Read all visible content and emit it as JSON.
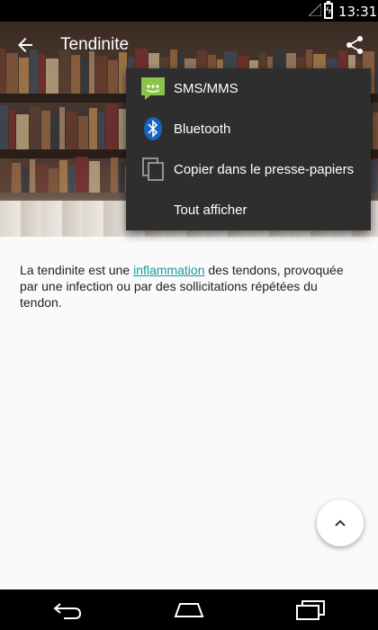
{
  "status_bar": {
    "time": "13:31"
  },
  "toolbar": {
    "title": "Tendinite"
  },
  "share_menu": {
    "items": [
      {
        "label": "SMS/MMS",
        "icon": "sms-icon"
      },
      {
        "label": "Bluetooth",
        "icon": "bluetooth-icon"
      },
      {
        "label": "Copier dans le presse-papiers",
        "icon": "copy-icon"
      },
      {
        "label": "Tout afficher",
        "icon": ""
      }
    ]
  },
  "article": {
    "before_link": "La tendinite est une ",
    "link_text": "inflammation",
    "after_link": " des tendons, provoquée par une infection ou par des sollicitations répétées du tendon."
  },
  "fab": {
    "icon": "chevron-up-icon"
  },
  "nav": {
    "back_icon": "back-icon",
    "home_icon": "home-icon",
    "recents_icon": "recents-icon"
  },
  "colors": {
    "link": "#1a9aa0",
    "menu_bg": "#2e2e2e",
    "sms_green": "#8bc34a"
  }
}
